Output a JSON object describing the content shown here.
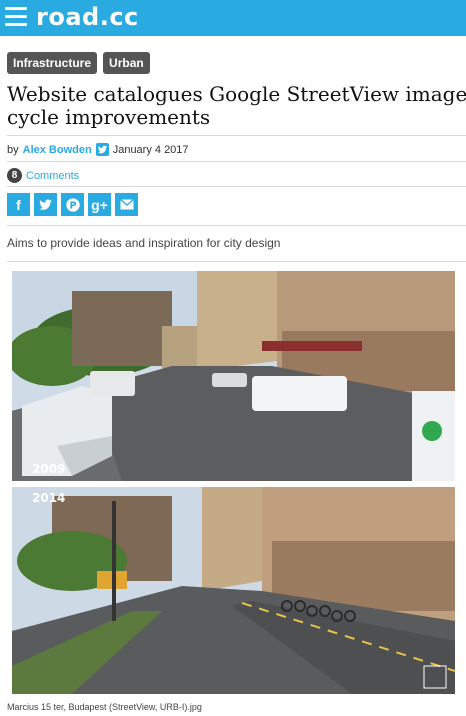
{
  "site": {
    "logo_text": "road.cc",
    "brand_color": "#29aae1"
  },
  "header": {
    "menu_icon": "hamburger-menu-icon"
  },
  "tags": [
    "Infrastructure",
    "Urban"
  ],
  "article": {
    "title_line1": "Website catalogues Google StreetView images b",
    "title_line2": "cycle improvements",
    "author_prefix": "by",
    "author": "Alex Bowden",
    "date": "January 4 2017",
    "comment_count": "8",
    "comments_label": "Comments",
    "standfirst": "Aims to provide ideas and inspiration for city design"
  },
  "share": [
    {
      "name": "facebook-share-button",
      "icon": "facebook-icon",
      "glyph": "f"
    },
    {
      "name": "twitter-share-button",
      "icon": "twitter-icon",
      "glyph": ""
    },
    {
      "name": "pinterest-share-button",
      "icon": "pinterest-icon",
      "glyph": "P"
    },
    {
      "name": "googleplus-share-button",
      "icon": "google-plus-icon",
      "glyph": "g+"
    },
    {
      "name": "email-share-button",
      "icon": "email-icon",
      "glyph": ""
    }
  ],
  "image": {
    "year_before": "2009",
    "year_after": "2014",
    "caption": "Marcius 15 ter, Budapest (StreetView, URB-I).jpg"
  }
}
